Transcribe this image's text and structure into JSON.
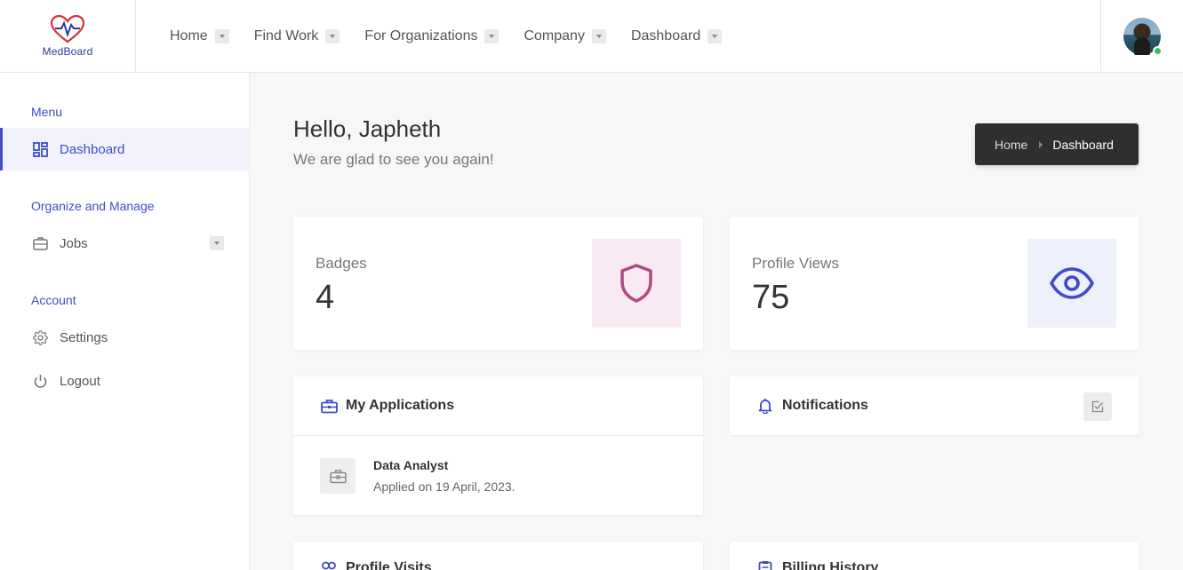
{
  "brand": {
    "name": "MedBoard"
  },
  "topnav": [
    {
      "label": "Home"
    },
    {
      "label": "Find Work"
    },
    {
      "label": "For Organizations"
    },
    {
      "label": "Company"
    },
    {
      "label": "Dashboard"
    }
  ],
  "sidebar": {
    "menu_heading": "Menu",
    "dashboard_label": "Dashboard",
    "organize_heading": "Organize and Manage",
    "jobs_label": "Jobs",
    "account_heading": "Account",
    "settings_label": "Settings",
    "logout_label": "Logout"
  },
  "greeting": {
    "title": "Hello, Japheth",
    "subtitle": "We are glad to see you again!"
  },
  "breadcrumb": {
    "home": "Home",
    "current": "Dashboard"
  },
  "stats": {
    "badges": {
      "label": "Badges",
      "value": "4"
    },
    "profile_views": {
      "label": "Profile Views",
      "value": "75"
    }
  },
  "applications": {
    "title": "My Applications",
    "items": [
      {
        "title": "Data Analyst",
        "date": "Applied on 19 April, 2023."
      }
    ]
  },
  "notifications": {
    "title": "Notifications"
  },
  "lower_cards": {
    "left_title": "Profile Visits",
    "right_title": "Billing History"
  },
  "colors": {
    "accent": "#3f4bc9",
    "badge_tint": "#f8e9f2",
    "badge_icon": "#b04a82",
    "views_tint": "#eef0fb",
    "breadcrumb_bg": "#2f2f2f"
  },
  "icons": {
    "logo": "heart-pulse-icon",
    "dashboard": "dashboard-grid-icon",
    "jobs": "briefcase-icon",
    "settings": "gear-icon",
    "logout": "power-icon",
    "badges": "shield-icon",
    "profile_views": "eye-icon",
    "applications": "briefcase-icon",
    "notifications": "bell-icon",
    "mark_read": "check-square-icon",
    "profile_visits": "users-icon",
    "billing": "clipboard-icon"
  }
}
